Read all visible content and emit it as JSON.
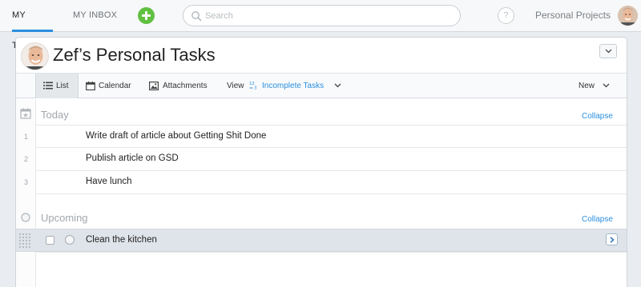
{
  "nav": {
    "tabs": [
      {
        "label": "MY TASKS",
        "active": true
      },
      {
        "label": "MY INBOX",
        "active": false
      }
    ],
    "add_icon": "plus-circle-icon",
    "search_placeholder": "Search",
    "help_label": "?",
    "workspace": "Personal Projects"
  },
  "project": {
    "title": "Zef’s Personal Tasks"
  },
  "toolbar": {
    "list": "List",
    "calendar": "Calendar",
    "attachments": "Attachments",
    "view": "View",
    "filter": "Incomplete Tasks",
    "new": "New"
  },
  "sections": [
    {
      "title": "Today",
      "collapse": "Collapse",
      "tasks": [
        {
          "num": "1",
          "name": "Write draft of article about Getting Shit Done"
        },
        {
          "num": "2",
          "name": "Publish article on GSD"
        },
        {
          "num": "3",
          "name": "Have lunch"
        }
      ]
    },
    {
      "title": "Upcoming",
      "collapse": "Collapse",
      "tasks": [
        {
          "num": "",
          "name": "Clean the kitchen",
          "selected": true
        }
      ]
    }
  ],
  "colors": {
    "accent": "#2a8fe0",
    "add_button": "#61c042",
    "selected_row": "#dfe4ea"
  }
}
